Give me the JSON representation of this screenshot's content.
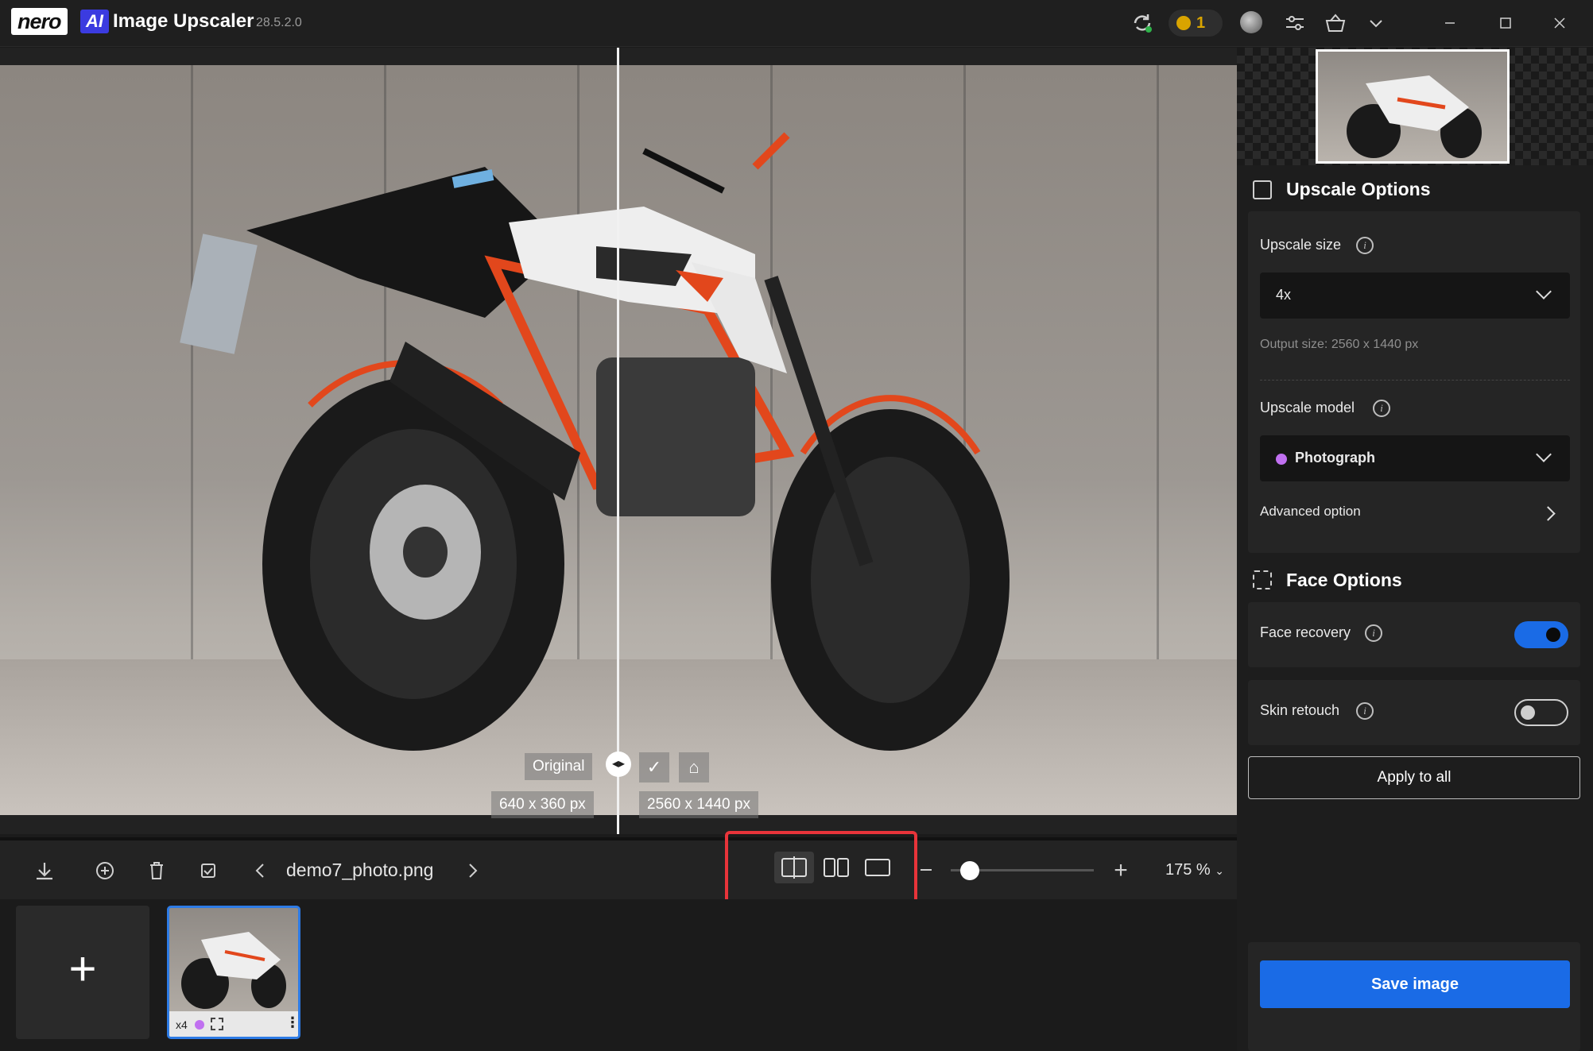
{
  "app": {
    "logo_nero": "nero",
    "logo_ai": "AI",
    "title": "Image Upscaler",
    "version": "28.5.2.0",
    "coins": "1",
    "icons": [
      "sync-icon",
      "coin-icon",
      "avatar",
      "settings-sliders-icon",
      "basket-icon",
      "chevron-down-icon",
      "minimize-icon",
      "maximize-icon",
      "close-icon"
    ]
  },
  "canvas": {
    "left_label": "Original",
    "left_size": "640 x 360 px",
    "right_size": "2560 x 1440 px"
  },
  "toolbar": {
    "filename": "demo7_photo.png",
    "zoom": "175 %",
    "zoom_fraction": 0.1
  },
  "panel": {
    "upscale_options_title": "Upscale Options",
    "upscale_size_label": "Upscale size",
    "upscale_size_value": "4x",
    "output_size": "Output size: 2560 x 1440 px",
    "upscale_model_label": "Upscale model",
    "upscale_model_value": "Photograph",
    "model_color": "#c070f0",
    "advanced_option": "Advanced option",
    "face_options_title": "Face Options",
    "face_recovery_label": "Face recovery",
    "face_recovery_on": true,
    "skin_retouch_label": "Skin retouch",
    "skin_retouch_on": false,
    "apply_all": "Apply to all",
    "save_image": "Save image"
  },
  "filmstrip": {
    "thumb_scale": "x4"
  },
  "colors": {
    "accent": "#1a6be6",
    "highlight": "#e8343a",
    "coin": "#d9a400"
  }
}
